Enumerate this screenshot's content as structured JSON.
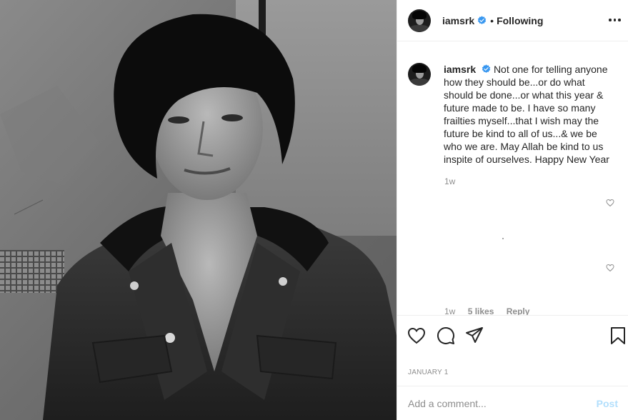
{
  "post": {
    "image_alt": "Black and white portrait of a man in a denim jacket",
    "date": "JANUARY 1"
  },
  "header": {
    "username": "iamsrk",
    "separator": "•",
    "follow_status": "Following",
    "verified_icon": "verified-badge-icon",
    "more_icon": "more-options-icon"
  },
  "caption": {
    "username": "iamsrk",
    "text": "Not one for telling anyone how they should be...or do what should be done...or what this year & future made to be. I have so many frailties myself...that I wish may the future be kind to all of us...& we be who we are. May Allah be kind to us inspite of ourselves. Happy New Year",
    "time": "1w"
  },
  "comment_meta": {
    "time": "1w",
    "likes": "5 likes",
    "reply": "Reply"
  },
  "actions": {
    "like_icon": "heart-icon",
    "comment_icon": "comment-icon",
    "share_icon": "share-icon",
    "save_icon": "bookmark-icon"
  },
  "comment_form": {
    "placeholder": "Add a comment...",
    "post_label": "Post"
  },
  "colors": {
    "verified": "#3897f0",
    "muted": "#8e8e8e",
    "post_disabled": "#b2dffc",
    "border": "#efefef"
  }
}
